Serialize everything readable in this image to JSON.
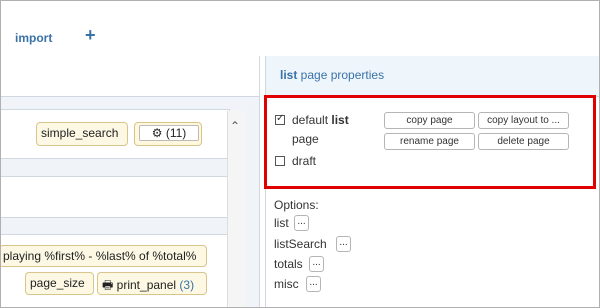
{
  "toolbar": {
    "import_label": "import",
    "add_label": "+"
  },
  "left": {
    "simple_search": "simple_search",
    "settings_count": "(11)",
    "displaying_text": "playing %first% - %last% of %total%",
    "page_size": "page_size",
    "print_panel": "print_panel",
    "print_panel_count": "(3)"
  },
  "right": {
    "title_bold": "list",
    "title_rest": " page properties",
    "default_prefix": "default ",
    "default_bold": "list",
    "default_page": "page",
    "default_checked": true,
    "draft_label": "draft",
    "draft_checked": false,
    "buttons": {
      "copy_page": "copy page",
      "copy_layout": "copy layout to ...",
      "rename_page": "rename page",
      "delete_page": "delete page"
    },
    "options_label": "Options:",
    "options": [
      "list",
      "listSearch",
      "totals",
      "misc"
    ],
    "dots": "..."
  },
  "colors": {
    "accent": "#3a72a8",
    "highlight": "#e00000",
    "chip_bg": "#fcf8e3"
  }
}
